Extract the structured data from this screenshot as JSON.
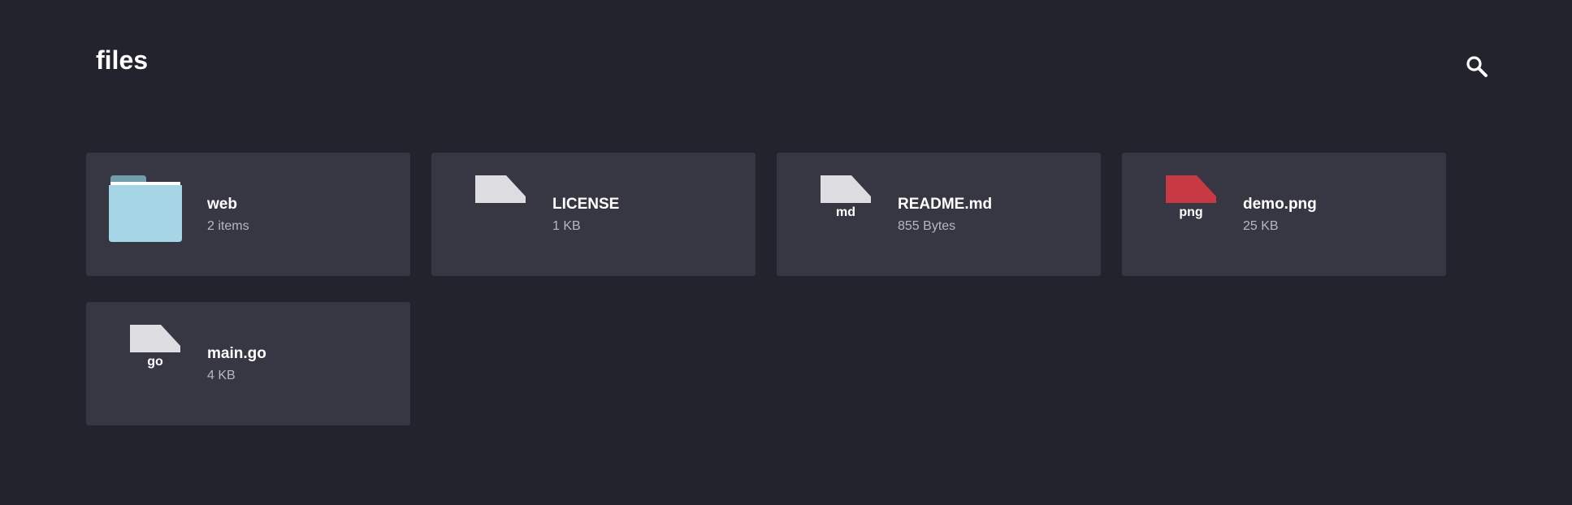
{
  "header": {
    "title": "files"
  },
  "icons": {
    "search": "search-icon",
    "folder": "folder-icon",
    "file": "file-icon"
  },
  "colors": {
    "background": "#23232e",
    "card": "#373743",
    "folder_front": "#a6d6e6",
    "folder_back": "#6f9fad",
    "file_default": "#dcdce1",
    "file_png": "#c83a43"
  },
  "items": [
    {
      "name": "web",
      "meta": "2 items",
      "type": "folder",
      "ext": ""
    },
    {
      "name": "LICENSE",
      "meta": "1 KB",
      "type": "file",
      "ext": ""
    },
    {
      "name": "README.md",
      "meta": "855 Bytes",
      "type": "file",
      "ext": "md"
    },
    {
      "name": "demo.png",
      "meta": "25 KB",
      "type": "file",
      "ext": "png"
    },
    {
      "name": "main.go",
      "meta": "4 KB",
      "type": "file",
      "ext": "go"
    }
  ]
}
